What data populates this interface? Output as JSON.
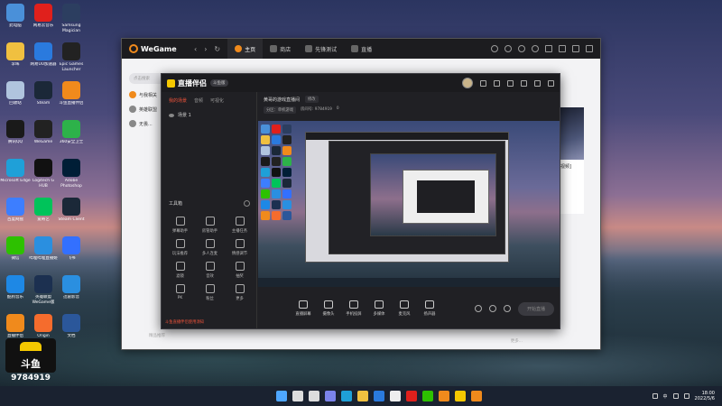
{
  "desktop": {
    "col1": [
      {
        "label": "此电脑",
        "color": "#4a90d9",
        "icon": "computer-icon"
      },
      {
        "label": "李晖",
        "color": "#f0c040",
        "icon": "folder-icon"
      },
      {
        "label": "回收站",
        "color": "#b0c4de",
        "icon": "recycle-bin-icon"
      },
      {
        "label": "腾讯QQ",
        "color": "#1a1a1a",
        "icon": "qq-icon"
      },
      {
        "label": "Microsoft Edge",
        "color": "#1fa0d8",
        "icon": "edge-icon"
      },
      {
        "label": "百度网盘",
        "color": "#3d7eff",
        "icon": "baidu-netdisk-icon"
      },
      {
        "label": "微信",
        "color": "#2dc100",
        "icon": "wechat-icon"
      },
      {
        "label": "酷狗音乐",
        "color": "#1e88e5",
        "icon": "kugou-icon"
      },
      {
        "label": "直播伴侣",
        "color": "#f08a1c",
        "icon": "live-companion-icon"
      }
    ],
    "col2": [
      {
        "label": "网易云音乐",
        "color": "#e0201c",
        "icon": "netease-music-icon"
      },
      {
        "label": "网易UU加速器",
        "color": "#2a7ade",
        "icon": "uu-accelerator-icon"
      },
      {
        "label": "Steam",
        "color": "#1b2838",
        "icon": "steam-icon"
      },
      {
        "label": "WeGame",
        "color": "#222222",
        "icon": "wegame-icon"
      },
      {
        "label": "Logitech G HUB",
        "color": "#111111",
        "icon": "logitech-icon"
      },
      {
        "label": "爱奇艺",
        "color": "#00c35a",
        "icon": "iqiyi-icon"
      },
      {
        "label": "哔哩哔哩直播姬",
        "color": "#2a8fe0",
        "icon": "bilibili-live-icon"
      },
      {
        "label": "英雄联盟WeGame版",
        "color": "#1c3050",
        "icon": "lol-icon"
      },
      {
        "label": "Origin",
        "color": "#f56c2d",
        "icon": "origin-icon"
      }
    ],
    "col3": [
      {
        "label": "Samsung Magician",
        "color": "#2c3e60",
        "icon": "samsung-magician-icon"
      },
      {
        "label": "Epic Games Launcher",
        "color": "#222222",
        "icon": "epic-icon"
      },
      {
        "label": "斗鱼直播伴侣",
        "color": "#f08a1c",
        "icon": "douyu-icon"
      },
      {
        "label": "360安全卫士",
        "color": "#2db24a",
        "icon": "360-icon"
      },
      {
        "label": "Adobe Photoshop",
        "color": "#001e36",
        "icon": "photoshop-icon"
      },
      {
        "label": "Steam Client",
        "color": "#1b2838",
        "icon": "steam-client-icon"
      },
      {
        "label": "飞书",
        "color": "#3370ff",
        "icon": "feishu-icon"
      },
      {
        "label": "迅雷影音",
        "color": "#2a8fe0",
        "icon": "xunlei-icon"
      },
      {
        "label": "文档",
        "color": "#2b579a",
        "icon": "word-icon"
      }
    ]
  },
  "watermark": {
    "logo_text": "斗鱼",
    "room_id": "9784919"
  },
  "wegame": {
    "logo": "WeGame",
    "back": "‹",
    "forward": "›",
    "refresh": "↻",
    "tabs": [
      "主页",
      "商店",
      "先锋测试",
      "直播"
    ],
    "search_placeholder": "点击搜索",
    "side_items": [
      "与我相关",
      "英雄联盟",
      "无畏..."
    ],
    "card_text": "[视频]",
    "bottom_text": "精品推荐",
    "bottom_text2": "更多..."
  },
  "live": {
    "title": "直播伴侣",
    "badge": "斗鱼版",
    "left_tabs": [
      "我的场景",
      "音频",
      "可视化"
    ],
    "scene": "场景 1",
    "tools_title": "工具箱",
    "tools": [
      "弹幕助手",
      "房管助手",
      "主播任务",
      "玩法推荐",
      "多人连麦",
      "情感调节",
      "滤镜",
      "音效",
      "抽奖",
      "PK",
      "粉丝",
      "更多"
    ],
    "notice": "斗鱼直播伴侣使用须知",
    "room_title": "黄哥的游戏直播间",
    "room_sub": "修改",
    "info_chips": [
      "分区：单机游戏",
      "房间号: 9784919",
      "0"
    ],
    "actions": [
      "直播屏幕",
      "摄像头",
      "手机投屏",
      "多媒体",
      "麦克风",
      "扬声器"
    ],
    "start_btn": "开始直播"
  },
  "taskbar": {
    "ime": "中",
    "time": "18:00",
    "date": "2022/5/6"
  }
}
